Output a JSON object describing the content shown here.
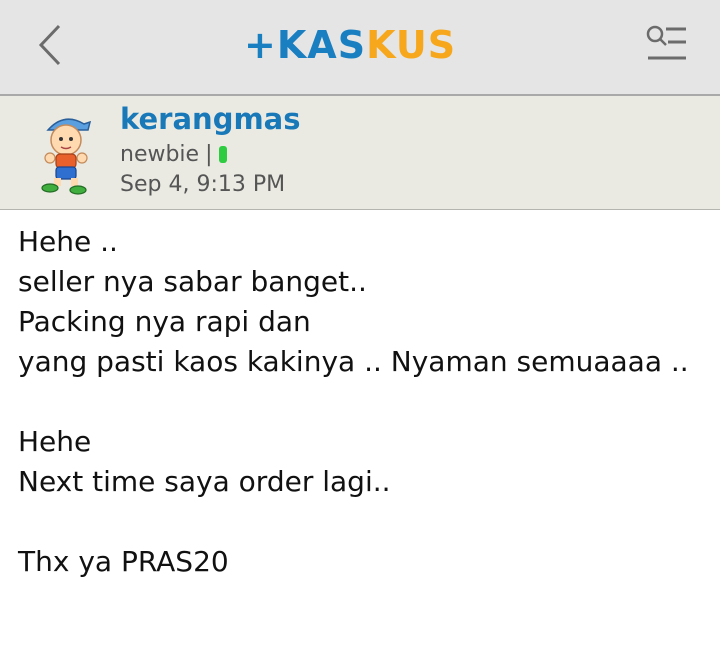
{
  "header": {
    "logo_part1": "KAS",
    "logo_part2": "KUS",
    "logo_plus": "+",
    "colors": {
      "blue": "#1a7fc1",
      "orange": "#f6a71b"
    },
    "back_icon": "chevron-left-icon",
    "menu_icon": "search-menu-icon"
  },
  "post": {
    "username": "kerangmas",
    "rank": "newbie",
    "separator": "|",
    "online_color": "#2ecc40",
    "time": "Sep 4, 9:13 PM",
    "lines": [
      "Hehe ..",
      "seller nya sabar banget..",
      "Packing nya rapi dan",
      "yang pasti kaos kakinya .. Nyaman semuaaaa ..",
      "",
      "Hehe",
      "Next time saya order lagi..",
      "",
      "Thx ya PRAS20"
    ]
  }
}
